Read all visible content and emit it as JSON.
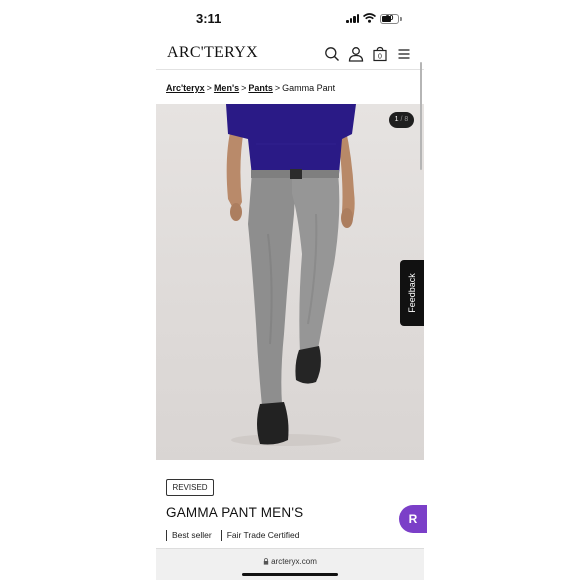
{
  "status_bar": {
    "time": "3:11",
    "battery": "30"
  },
  "header": {
    "logo": "ARC'TERYX"
  },
  "breadcrumb": {
    "items": [
      "Arc'teryx",
      "Men's",
      "Pants"
    ],
    "current": "Gamma Pant",
    "separator": ">"
  },
  "gallery": {
    "current": "1",
    "separator": "/",
    "total": "8"
  },
  "feedback": {
    "label": "Feedback"
  },
  "product": {
    "tag": "REVISED",
    "title": "GAMMA PANT MEN'S",
    "badges": [
      "Best seller",
      "Fair Trade Certified"
    ]
  },
  "chat_button": {
    "label": "R"
  },
  "browser": {
    "url": "arcteryx.com"
  },
  "colors": {
    "accent_purple": "#7b3fc8",
    "shirt": "#2a1a86",
    "pants": "#8e8e8e"
  }
}
